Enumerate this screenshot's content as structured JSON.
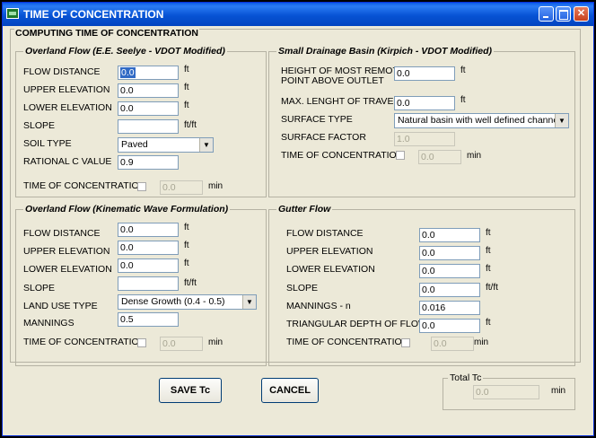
{
  "window": {
    "title": "TIME OF CONCENTRATION"
  },
  "main": {
    "title": "COMPUTING TIME OF CONCENTRATION"
  },
  "overland_seelye": {
    "title": "Overland Flow (E.E. Seelye - VDOT Modified)",
    "flow_distance": {
      "label": "FLOW DISTANCE",
      "value": "0.0",
      "unit": "ft"
    },
    "upper_elevation": {
      "label": "UPPER ELEVATION",
      "value": "0.0",
      "unit": "ft"
    },
    "lower_elevation": {
      "label": "LOWER ELEVATION",
      "value": "0.0",
      "unit": "ft"
    },
    "slope": {
      "label": "SLOPE",
      "value": "",
      "unit": "ft/ft"
    },
    "soil_type": {
      "label": "SOIL TYPE",
      "value": "Paved"
    },
    "rational_c": {
      "label": "RATIONAL C VALUE",
      "value": "0.9"
    },
    "tc": {
      "label": "TIME OF CONCENTRATION",
      "value": "0.0",
      "unit": "min"
    }
  },
  "kirpich": {
    "title": "Small Drainage Basin (Kirpich - VDOT Modified)",
    "height": {
      "label_line1": "HEIGHT OF MOST REMOTE",
      "label_line2": "POINT ABOVE OUTLET",
      "value": "0.0",
      "unit": "ft"
    },
    "max_length": {
      "label": "MAX. LENGHT OF TRAVEL",
      "value": "0.0",
      "unit": "ft"
    },
    "surface_type": {
      "label": "SURFACE TYPE",
      "value": "Natural basin with well defined channel"
    },
    "surface_factor": {
      "label": "SURFACE FACTOR",
      "value": "1.0"
    },
    "tc": {
      "label": "TIME OF CONCENTRATION",
      "value": "0.0",
      "unit": "min"
    }
  },
  "kinematic": {
    "title": "Overland Flow (Kinematic Wave Formulation)",
    "flow_distance": {
      "label": "FLOW DISTANCE",
      "value": "0.0",
      "unit": "ft"
    },
    "upper_elevation": {
      "label": "UPPER ELEVATION",
      "value": "0.0",
      "unit": "ft"
    },
    "lower_elevation": {
      "label": "LOWER ELEVATION",
      "value": "0.0",
      "unit": "ft"
    },
    "slope": {
      "label": "SLOPE",
      "value": "",
      "unit": "ft/ft"
    },
    "land_use": {
      "label": "LAND USE TYPE",
      "value": "Dense Growth (0.4 - 0.5)"
    },
    "mannings": {
      "label": "MANNINGS",
      "value": "0.5"
    },
    "tc": {
      "label": "TIME OF CONCENTRATION",
      "value": "0.0",
      "unit": "min"
    }
  },
  "gutter": {
    "title": "Gutter Flow",
    "flow_distance": {
      "label": "FLOW DISTANCE",
      "value": "0.0",
      "unit": "ft"
    },
    "upper_elevation": {
      "label": "UPPER ELEVATION",
      "value": "0.0",
      "unit": "ft"
    },
    "lower_elevation": {
      "label": "LOWER ELEVATION",
      "value": "0.0",
      "unit": "ft"
    },
    "slope": {
      "label": "SLOPE",
      "value": "0.0",
      "unit": "ft/ft"
    },
    "mannings": {
      "label": "MANNINGS - n",
      "value": "0.016"
    },
    "depth": {
      "label": "TRIANGULAR DEPTH OF FLOW",
      "value": "0.0",
      "unit": "ft"
    },
    "tc": {
      "label": "TIME OF CONCENTRATION",
      "value": "0.0",
      "unit": "min"
    }
  },
  "footer": {
    "save_label": "SAVE Tc",
    "cancel_label": "CANCEL",
    "total": {
      "label": "Total Tc",
      "value": "0.0",
      "unit": "min"
    }
  }
}
